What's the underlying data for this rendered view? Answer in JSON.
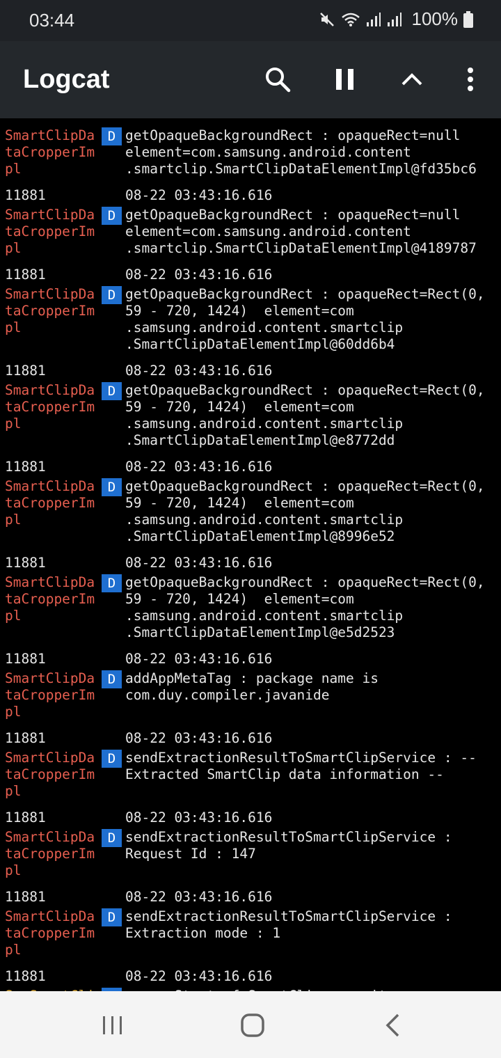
{
  "status": {
    "time": "03:44",
    "battery": "100%"
  },
  "toolbar": {
    "title": "Logcat"
  },
  "entries": [
    {
      "pid": "",
      "time": "",
      "tag": "SmartClipDa\ntaCropperIm\npl",
      "level": "D",
      "message": "getOpaqueBackgroundRect : opaqueRect=null\nelement=com.samsung.android.content\n.smartclip.SmartClipDataElementImpl@fd35bc6",
      "color": "#e75f50"
    },
    {
      "pid": "11881",
      "time": "08-22 03:43:16.616",
      "tag": "SmartClipDa\ntaCropperIm\npl",
      "level": "D",
      "message": "getOpaqueBackgroundRect : opaqueRect=null\nelement=com.samsung.android.content\n.smartclip.SmartClipDataElementImpl@4189787",
      "color": "#e75f50"
    },
    {
      "pid": "11881",
      "time": "08-22 03:43:16.616",
      "tag": "SmartClipDa\ntaCropperIm\npl",
      "level": "D",
      "message": "getOpaqueBackgroundRect : opaqueRect=Rect(0,\n59 - 720, 1424)  element=com\n.samsung.android.content.smartclip\n.SmartClipDataElementImpl@60dd6b4",
      "color": "#e75f50"
    },
    {
      "pid": "11881",
      "time": "08-22 03:43:16.616",
      "tag": "SmartClipDa\ntaCropperIm\npl",
      "level": "D",
      "message": "getOpaqueBackgroundRect : opaqueRect=Rect(0,\n59 - 720, 1424)  element=com\n.samsung.android.content.smartclip\n.SmartClipDataElementImpl@e8772dd",
      "color": "#e75f50"
    },
    {
      "pid": "11881",
      "time": "08-22 03:43:16.616",
      "tag": "SmartClipDa\ntaCropperIm\npl",
      "level": "D",
      "message": "getOpaqueBackgroundRect : opaqueRect=Rect(0,\n59 - 720, 1424)  element=com\n.samsung.android.content.smartclip\n.SmartClipDataElementImpl@8996e52",
      "color": "#e75f50"
    },
    {
      "pid": "11881",
      "time": "08-22 03:43:16.616",
      "tag": "SmartClipDa\ntaCropperIm\npl",
      "level": "D",
      "message": "getOpaqueBackgroundRect : opaqueRect=Rect(0,\n59 - 720, 1424)  element=com\n.samsung.android.content.smartclip\n.SmartClipDataElementImpl@e5d2523",
      "color": "#e75f50"
    },
    {
      "pid": "11881",
      "time": "08-22 03:43:16.616",
      "tag": "SmartClipDa\ntaCropperIm\npl",
      "level": "D",
      "message": "addAppMetaTag : package name is\ncom.duy.compiler.javanide",
      "color": "#e75f50"
    },
    {
      "pid": "11881",
      "time": "08-22 03:43:16.616",
      "tag": "SmartClipDa\ntaCropperIm\npl",
      "level": "D",
      "message": "sendExtractionResultToSmartClipService : --\nExtracted SmartClip data information --",
      "color": "#e75f50"
    },
    {
      "pid": "11881",
      "time": "08-22 03:43:16.616",
      "tag": "SmartClipDa\ntaCropperIm\npl",
      "level": "D",
      "message": "sendExtractionResultToSmartClipService :\nRequest Id : 147",
      "color": "#e75f50"
    },
    {
      "pid": "11881",
      "time": "08-22 03:43:16.616",
      "tag": "SmartClipDa\ntaCropperIm\npl",
      "level": "D",
      "message": "sendExtractionResultToSmartClipService :\nExtraction mode : 1",
      "color": "#e75f50"
    },
    {
      "pid": "11881",
      "time": "08-22 03:43:16.616",
      "tag": "SemSmartCli\npDataReposi\ntory",
      "level": "D",
      "message": "----- Start of SmartClip repository\ninformations -----",
      "color": "#d4a53c"
    }
  ]
}
